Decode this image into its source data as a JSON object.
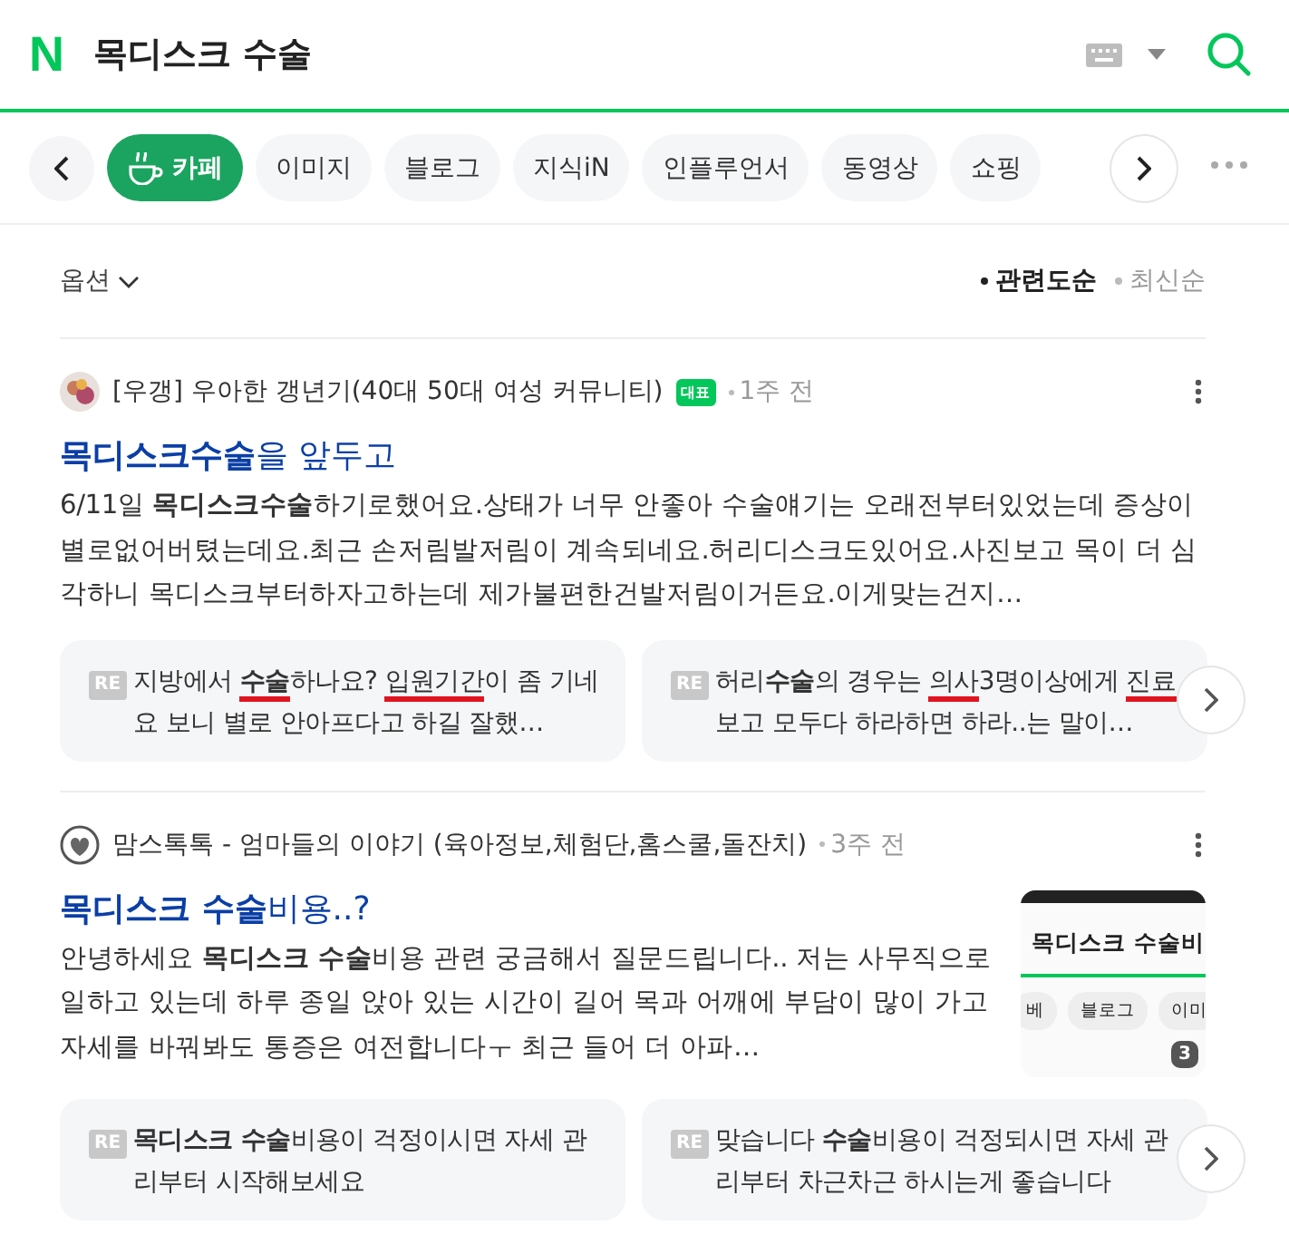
{
  "header": {
    "logo": "N",
    "query": "목디스크 수술"
  },
  "tabs": [
    {
      "label": "카페",
      "selected": true,
      "kind": "icon"
    },
    {
      "label": "이미지",
      "selected": false,
      "kind": "plain"
    },
    {
      "label": "블로그",
      "selected": false,
      "kind": "plain"
    },
    {
      "label": "지식iN",
      "selected": false,
      "kind": "plain"
    },
    {
      "label": "인플루언서",
      "selected": false,
      "kind": "plain"
    },
    {
      "label": "동영상",
      "selected": false,
      "kind": "plain"
    },
    {
      "label": "쇼핑",
      "selected": false,
      "kind": "plain"
    }
  ],
  "options": {
    "label": "옵션",
    "sorts": [
      {
        "label": "관련도순",
        "selected": true
      },
      {
        "label": "최신순",
        "selected": false
      }
    ]
  },
  "posts": [
    {
      "source": "[우갱] 우아한 갱년기(40대 50대 여성 커뮤니티)",
      "badge": "대표",
      "time": "1주 전",
      "title": "**목디스크수술**을 앞두고",
      "body": "6/11일 **목디스크수술**하기로했어요.상태가 너무 안좋아 수술얘기는 오래전부터있었는데 증상이 별로없어버텼는데요.최근 손저림발저림이 계속되네요.허리디스크도있어요.사진보고 목이 더 심각하니 목디스크부터하자고하는데 제가불편한건발저림이거든요.이게맞는건지…",
      "replies": [
        [
          {
            "text": "RE",
            "kind": "tag"
          },
          {
            "text": "지방에서 ",
            "underlined": false
          },
          {
            "text": "**수술**",
            "underlined": true
          },
          {
            "text": "하나요? ",
            "underlined": false
          },
          {
            "text": "입원기간",
            "underlined": true
          },
          {
            "text": "이 좀 기네요 보니 별로 안아프다고 하길 잘했…",
            "underlined": false
          }
        ],
        [
          {
            "text": "RE",
            "kind": "tag"
          },
          {
            "text": "허리**수술**의 경우는 ",
            "underlined": false
          },
          {
            "text": "의사",
            "underlined": true
          },
          {
            "text": "3명이상에게 ",
            "underlined": false
          },
          {
            "text": "진료",
            "underlined": true
          },
          {
            "text": "보고 모두다 하라하면 하라..는 말이…",
            "underlined": false
          }
        ]
      ]
    },
    {
      "source": "맘스톡톡 - 엄마들의 이야기 (육아정보,체험단,홈스쿨,돌잔치)",
      "time": "3주 전",
      "title": "**목디스크 수술**비용..?",
      "body": "안녕하세요 **목디스크 수술**비용 관련 궁금해서 질문드립니다.. 저는 사무직으로 일하고 있는데 하루 종일 앉아 있는 시간이 길어 목과 어깨에 부담이 많이 가고 자세를 바꿔봐도 통증은 여전합니다ㅜ 최근 들어 더 아파…",
      "thumbnail": {
        "title": "목디스크 수술비",
        "chips": [
          "베",
          "블로그",
          "이미"
        ],
        "count": "3"
      },
      "replies": [
        [
          {
            "text": "RE",
            "kind": "tag"
          },
          {
            "text": "**목디스크 수술**비용이 걱정이시면 자세 관리부터 시작해보세요",
            "underlined": false
          }
        ],
        [
          {
            "text": "RE",
            "kind": "tag"
          },
          {
            "text": "맞습니다 **수술**비용이 걱정되시면 자세 관리부터 차근차근 하시는게 좋습니다",
            "underlined": false
          }
        ]
      ]
    }
  ]
}
